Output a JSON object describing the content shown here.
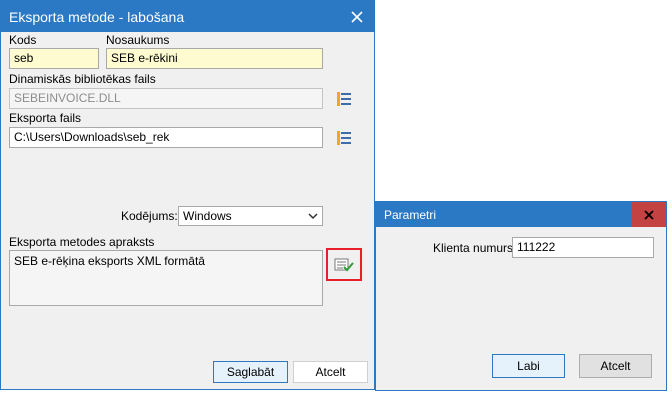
{
  "main_window": {
    "title": "Eksporta metode - labošana",
    "close_glyph": "✕",
    "kods_label": "Kods",
    "kods_value": "seb",
    "nosaukums_label": "Nosaukums",
    "nosaukums_value": "SEB e-rēkini",
    "dll_label": "Dinamiskās bibliotēkas fails",
    "dll_value": "SEBEINVOICE.DLL",
    "export_file_label": "Eksporta fails",
    "export_file_value": "C:\\Users\\Downloads\\seb_rek",
    "encoding_label": "Kodējums:",
    "encoding_value": "Windows",
    "description_label": "Eksporta metodes apraksts",
    "description_value": "SEB e-rēķina eksports XML formātā",
    "save_label": "Saglabāt",
    "cancel_label": "Atcelt"
  },
  "param_window": {
    "title": "Parametri",
    "close_glyph": "✕",
    "client_number_label": "Klienta numurs:",
    "client_number_value": "111222",
    "ok_label": "Labi",
    "cancel_label": "Atcelt"
  },
  "icons": {
    "browse": "folder-tree-icon",
    "params": "parameters-check-icon",
    "dropdown": "chevron-down-icon"
  },
  "colors": {
    "titlebar": "#2b78c5",
    "close_active": "#c44242",
    "required_field": "#fdfbcf",
    "highlight": "#e81e2a"
  }
}
